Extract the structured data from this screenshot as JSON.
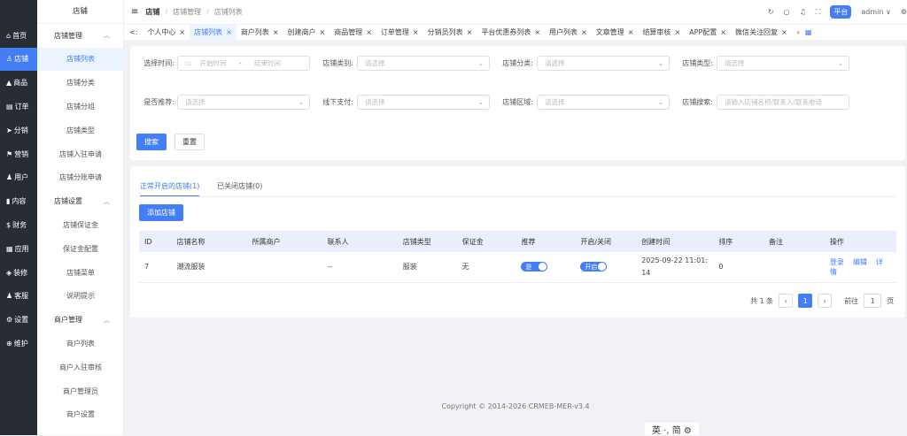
{
  "side": [
    "首页",
    "店铺",
    "商品",
    "订单",
    "分销",
    "营销",
    "用户",
    "内容",
    "财务",
    "应用",
    "装修",
    "客服",
    "设置",
    "维护"
  ],
  "side_icons": [
    "⌂",
    "♙",
    "▲",
    "▤",
    "➤",
    "⚑",
    "♟",
    "▮",
    "$",
    "▦",
    "◈",
    "♟",
    "⚙",
    "⊕"
  ],
  "sub": {
    "title": "店铺",
    "items": [
      {
        "t": "店铺管理",
        "g": 1
      },
      {
        "t": "店铺列表",
        "a": 1
      },
      {
        "t": "店铺分类"
      },
      {
        "t": "店铺分组"
      },
      {
        "t": "店铺类型"
      },
      {
        "t": "店铺入驻申请"
      },
      {
        "t": "店铺分账申请"
      },
      {
        "t": "店铺设置",
        "g": 1
      },
      {
        "t": "店铺保证金"
      },
      {
        "t": "保证金配置"
      },
      {
        "t": "店铺菜单"
      },
      {
        "t": "说明提示"
      },
      {
        "t": "商户管理",
        "g": 1
      },
      {
        "t": "商户列表"
      },
      {
        "t": "商户入驻审核"
      },
      {
        "t": "商户管理员"
      },
      {
        "t": "商户设置"
      }
    ]
  },
  "header": {
    "title": "店铺",
    "crumb1": "店铺管理",
    "crumb2": "店铺列表",
    "platform": "平台",
    "user": "admin"
  },
  "tabs": [
    "个人中心",
    "店铺列表",
    "商户列表",
    "创建商户",
    "商品管理",
    "订单管理",
    "分销员列表",
    "平台优惠券列表",
    "用户列表",
    "文章管理",
    "结算审核",
    "APP配置",
    "微信关注回复"
  ],
  "filters": {
    "time_label": "选择时间:",
    "start": "开始时间",
    "dash": "-",
    "end": "结束时间",
    "cat_label": "店铺类别:",
    "cls_label": "店铺分类:",
    "type_label": "店铺类型:",
    "rec_label": "是否推荐:",
    "offline_label": "线下支付:",
    "region_label": "店铺区域:",
    "search_label": "店铺搜索:",
    "select_ph": "请选择",
    "search_ph": "请输入店铺名称/联系人/联系电话",
    "search_btn": "搜索",
    "reset_btn": "重置"
  },
  "list": {
    "tab_open": "正常开启的店铺(1)",
    "tab_closed": "已关闭店铺(0)",
    "add_btn": "添加店铺",
    "columns": [
      "ID",
      "店铺名称",
      "所属商户",
      "联系人",
      "店铺类型",
      "保证金",
      "推荐",
      "开启/关闭",
      "创建时间",
      "排序",
      "备注",
      "操作"
    ],
    "rows": [
      {
        "id": "7",
        "name": "潮流服装",
        "merchant": "",
        "contact": "--",
        "type": "服装",
        "deposit": "无",
        "recommend": "是",
        "open": "开启",
        "created": "2025-09-22 11:01:14",
        "sort": "0",
        "remark": "",
        "ops": [
          "登录",
          "编辑",
          "详情"
        ]
      }
    ]
  },
  "pagination": {
    "total": "共 1 条",
    "page": "1",
    "goto": "前往",
    "goto_value": "1",
    "page_unit": "页"
  },
  "footer": {
    "copyright": "Copyright © 2014-2026 CRMEB-MER-v3.4",
    "lang": "英 ·, 简 ⚙"
  }
}
